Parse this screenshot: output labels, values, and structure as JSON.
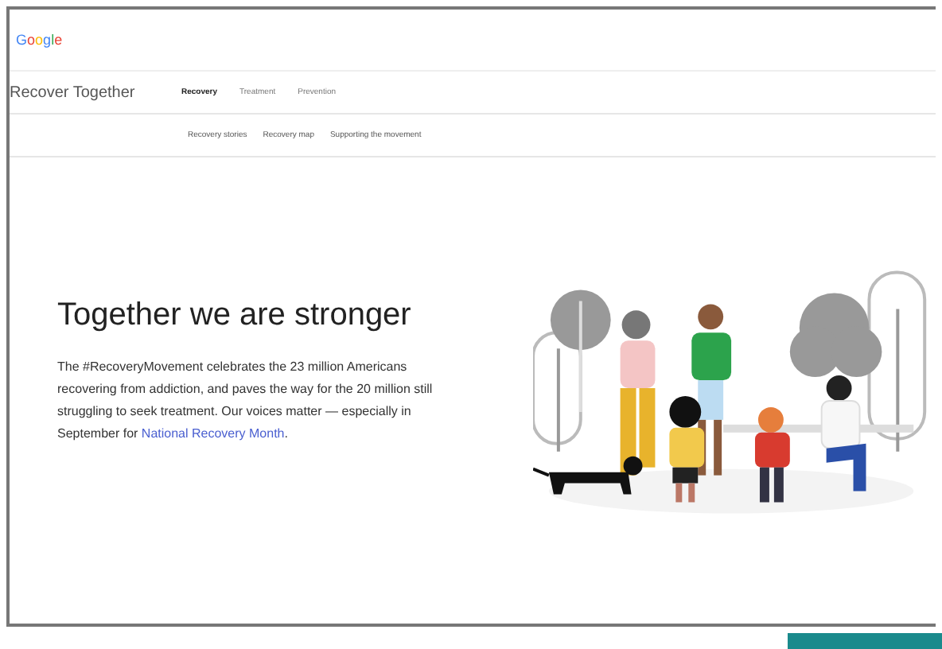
{
  "logo": "Google",
  "site_title": "Recover Together",
  "nav": [
    {
      "label": "Recovery",
      "selected": true
    },
    {
      "label": "Treatment",
      "selected": false
    },
    {
      "label": "Prevention",
      "selected": false
    }
  ],
  "subnav": [
    {
      "label": "Recovery stories"
    },
    {
      "label": "Recovery map"
    },
    {
      "label": "Supporting the movement"
    }
  ],
  "hero": {
    "heading": "Together we are stronger",
    "text": "The #RecoveryMovement celebrates the 23 million Americans recovering from addiction, and paves the way for the 20 million still struggling to seek treatment. Our voices matter — especially in September for ",
    "link": "National Recovery Month",
    "text_end": "."
  }
}
